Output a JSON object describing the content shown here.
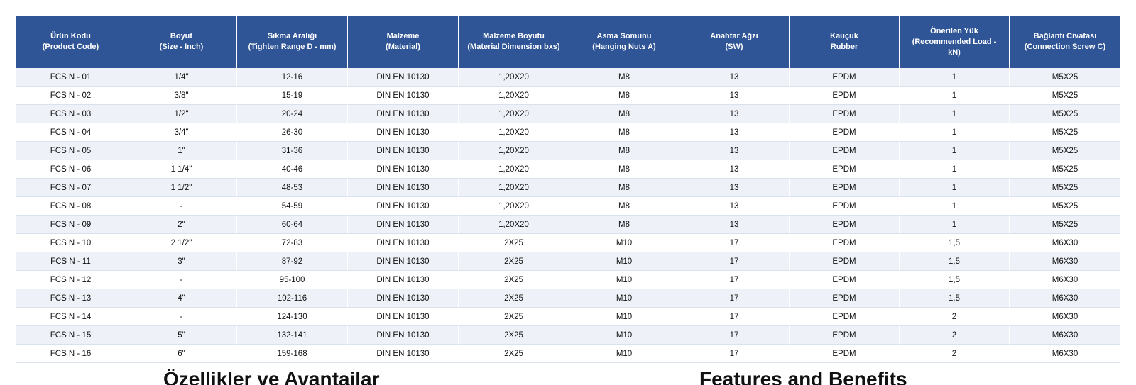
{
  "table": {
    "headers": [
      [
        "Ürün Kodu",
        "(Product Code)"
      ],
      [
        "Boyut",
        "(Size - Inch)"
      ],
      [
        "Sıkma Aralığı",
        "(Tighten Range D - mm)"
      ],
      [
        "Malzeme",
        "(Material)"
      ],
      [
        "Malzeme Boyutu",
        "(Material Dimension bxs)"
      ],
      [
        "Asma Somunu",
        "(Hanging Nuts A)"
      ],
      [
        "Anahtar Ağzı",
        "(SW)"
      ],
      [
        "Kauçuk",
        "Rubber"
      ],
      [
        "Önerilen Yük",
        "(Recommended Load -",
        "kN)"
      ],
      [
        "Bağlantı Civatası",
        "(Connection Screw C)"
      ]
    ],
    "rows": [
      [
        "FCS N - 01",
        "1/4\"",
        "12-16",
        "DIN EN 10130",
        "1,20X20",
        "M8",
        "13",
        "EPDM",
        "1",
        "M5X25"
      ],
      [
        "FCS N - 02",
        "3/8\"",
        "15-19",
        "DIN EN 10130",
        "1,20X20",
        "M8",
        "13",
        "EPDM",
        "1",
        "M5X25"
      ],
      [
        "FCS N - 03",
        "1/2\"",
        "20-24",
        "DIN EN 10130",
        "1,20X20",
        "M8",
        "13",
        "EPDM",
        "1",
        "M5X25"
      ],
      [
        "FCS N - 04",
        "3/4\"",
        "26-30",
        "DIN EN 10130",
        "1,20X20",
        "M8",
        "13",
        "EPDM",
        "1",
        "M5X25"
      ],
      [
        "FCS N - 05",
        "1\"",
        "31-36",
        "DIN EN 10130",
        "1,20X20",
        "M8",
        "13",
        "EPDM",
        "1",
        "M5X25"
      ],
      [
        "FCS N - 06",
        "1 1/4\"",
        "40-46",
        "DIN EN 10130",
        "1,20X20",
        "M8",
        "13",
        "EPDM",
        "1",
        "M5X25"
      ],
      [
        "FCS N - 07",
        "1 1/2\"",
        "48-53",
        "DIN EN 10130",
        "1,20X20",
        "M8",
        "13",
        "EPDM",
        "1",
        "M5X25"
      ],
      [
        "FCS N - 08",
        "-",
        "54-59",
        "DIN EN 10130",
        "1,20X20",
        "M8",
        "13",
        "EPDM",
        "1",
        "M5X25"
      ],
      [
        "FCS N - 09",
        "2\"",
        "60-64",
        "DIN EN 10130",
        "1,20X20",
        "M8",
        "13",
        "EPDM",
        "1",
        "M5X25"
      ],
      [
        "FCS N - 10",
        "2 1/2\"",
        "72-83",
        "DIN EN 10130",
        "2X25",
        "M10",
        "17",
        "EPDM",
        "1,5",
        "M6X30"
      ],
      [
        "FCS N - 11",
        "3\"",
        "87-92",
        "DIN EN 10130",
        "2X25",
        "M10",
        "17",
        "EPDM",
        "1,5",
        "M6X30"
      ],
      [
        "FCS N - 12",
        "-",
        "95-100",
        "DIN EN 10130",
        "2X25",
        "M10",
        "17",
        "EPDM",
        "1,5",
        "M6X30"
      ],
      [
        "FCS N - 13",
        "4\"",
        "102-116",
        "DIN EN 10130",
        "2X25",
        "M10",
        "17",
        "EPDM",
        "1,5",
        "M6X30"
      ],
      [
        "FCS N - 14",
        "-",
        "124-130",
        "DIN EN 10130",
        "2X25",
        "M10",
        "17",
        "EPDM",
        "2",
        "M6X30"
      ],
      [
        "FCS N - 15",
        "5\"",
        "132-141",
        "DIN EN 10130",
        "2X25",
        "M10",
        "17",
        "EPDM",
        "2",
        "M6X30"
      ],
      [
        "FCS N - 16",
        "6\"",
        "159-168",
        "DIN EN 10130",
        "2X25",
        "M10",
        "17",
        "EPDM",
        "2",
        "M6X30"
      ]
    ]
  },
  "footer": {
    "left_heading": "Özellikler ve Avantajlar",
    "right_heading": "Features and Benefits"
  },
  "colors": {
    "header_bg": "#2f5597",
    "row_stripe": "#eef2f8"
  }
}
